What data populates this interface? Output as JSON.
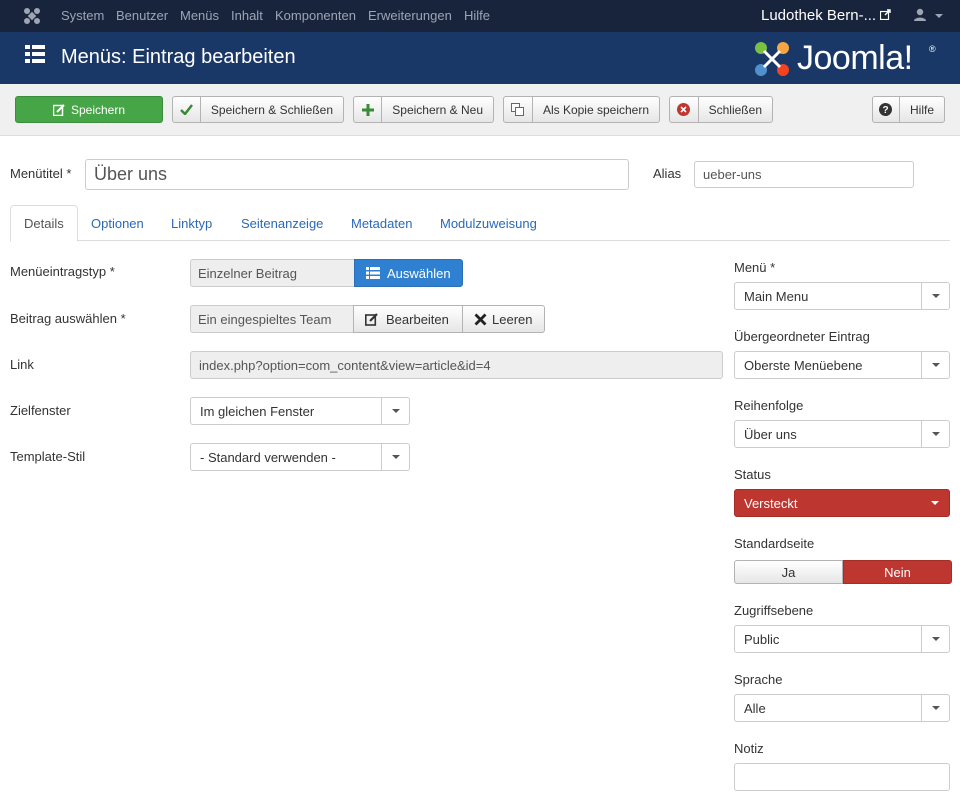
{
  "topbar": {
    "nav": [
      "System",
      "Benutzer",
      "Menüs",
      "Inhalt",
      "Komponenten",
      "Erweiterungen",
      "Hilfe"
    ],
    "site_name": "Ludothek Bern-..."
  },
  "header": {
    "title": "Menüs: Eintrag bearbeiten",
    "brand": "Joomla!",
    "brand_reg": "®"
  },
  "toolbar": {
    "save": "Speichern",
    "save_close": "Speichern & Schließen",
    "save_new": "Speichern & Neu",
    "save_copy": "Als Kopie speichern",
    "close": "Schließen",
    "help": "Hilfe"
  },
  "form": {
    "title_label": "Menütitel *",
    "title_value": "Über uns",
    "alias_label": "Alias",
    "alias_value": "ueber-uns"
  },
  "tabs": [
    "Details",
    "Optionen",
    "Linktyp",
    "Seitenanzeige",
    "Metadaten",
    "Modulzuweisung"
  ],
  "details": {
    "type_label": "Menüeintragstyp *",
    "type_value": "Einzelner Beitrag",
    "type_button": "Auswählen",
    "article_label": "Beitrag auswählen *",
    "article_value": "Ein eingespieltes Team",
    "edit_button": "Bearbeiten",
    "clear_button": "Leeren",
    "link_label": "Link",
    "link_value": "index.php?option=com_content&view=article&id=4",
    "target_label": "Zielfenster",
    "target_value": "Im gleichen Fenster",
    "template_label": "Template-Stil",
    "template_value": "- Standard verwenden -"
  },
  "sidebar": {
    "menu_label": "Menü *",
    "menu_value": "Main Menu",
    "parent_label": "Übergeordneter Eintrag",
    "parent_value": "Oberste Menüebene",
    "order_label": "Reihenfolge",
    "order_value": "Über uns",
    "status_label": "Status",
    "status_value": "Versteckt",
    "home_label": "Standardseite",
    "home_yes": "Ja",
    "home_no": "Nein",
    "access_label": "Zugriffsebene",
    "access_value": "Public",
    "language_label": "Sprache",
    "language_value": "Alle",
    "note_label": "Notiz",
    "note_value": ""
  },
  "colors": {
    "topbar": "#17243b",
    "header": "#1a3867",
    "save_green": "#46a546",
    "primary_blue": "#2f80d1",
    "danger_red": "#bd362f",
    "link_blue": "#2a69b8"
  }
}
